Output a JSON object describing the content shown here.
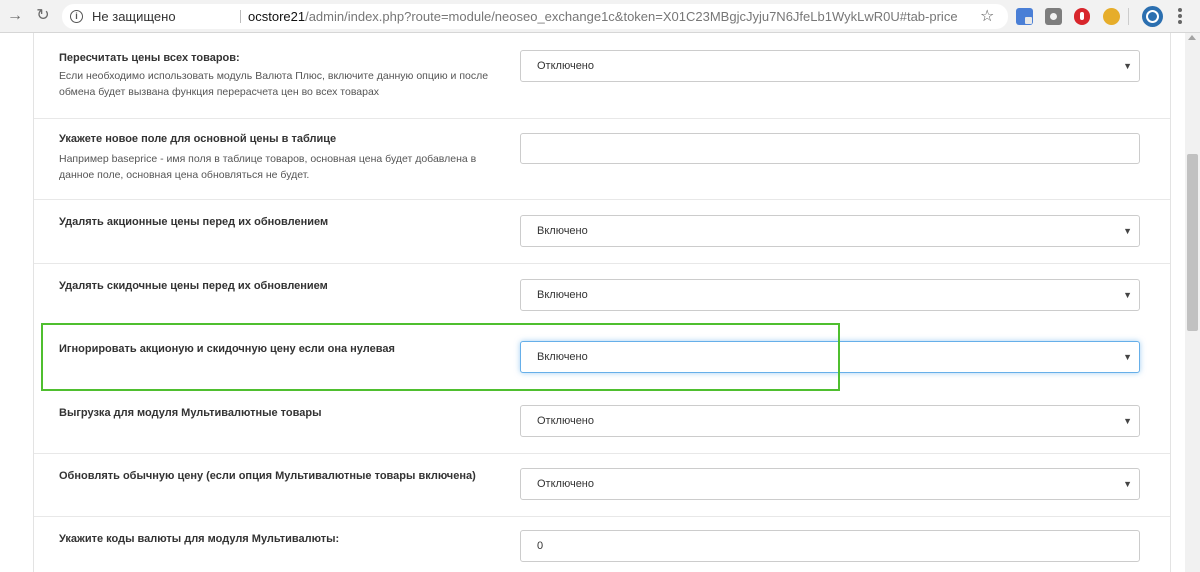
{
  "browser": {
    "security_label": "Не защищено",
    "url_host": "ocstore21",
    "url_rest": "/admin/index.php?route=module/neoseo_exchange1c&token=X01C23MBgjcJyju7N6JfeLb1WykLwR0U#tab-price"
  },
  "settings": [
    {
      "label": "Пересчитать цены всех товаров:",
      "help": "Если необходимо использовать модуль Валюта Плюс, включите данную опцию и после обмена будет вызвана функция перерасчета цен во всех товарах",
      "type": "select",
      "value": "Отключено"
    },
    {
      "label": "Укажете новое поле для основной цены в таблице",
      "help": "Например baseprice - имя поля в таблице товаров, основная цена будет добавлена в данное поле, основная цена обновляться не будет.",
      "type": "text",
      "value": ""
    },
    {
      "label": "Удалять акционные цены перед их обновлением",
      "type": "select",
      "value": "Включено"
    },
    {
      "label": "Удалять скидочные цены перед их обновлением",
      "type": "select",
      "value": "Включено"
    },
    {
      "label": "Игнорировать акционую и скидочную цену если она нулевая",
      "type": "select",
      "value": "Включено"
    },
    {
      "label": "Выгрузка для модуля Мультивалютные товары",
      "type": "select",
      "value": "Отключено"
    },
    {
      "label": "Обновлять обычную цену (если опция Мультивалютные товары включена)",
      "type": "select",
      "value": "Отключено"
    },
    {
      "label": "Укажите коды валюты для модуля Мультивалюты:",
      "type": "text",
      "value": "0"
    }
  ],
  "colors": {
    "highlight_box": "#4fbf2f",
    "focus_ring": "#66afe9"
  }
}
